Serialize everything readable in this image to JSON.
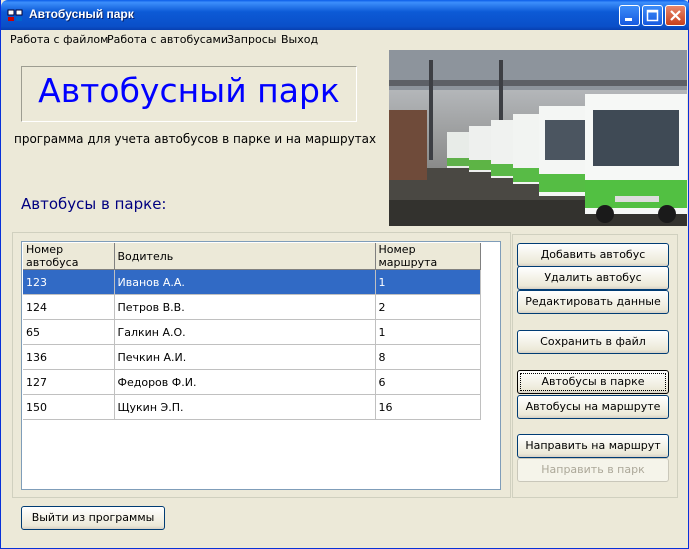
{
  "window": {
    "title": "Автобусный парк"
  },
  "menu": [
    {
      "label": "Работа с файлом"
    },
    {
      "label": "Работа с автобусами"
    },
    {
      "label": "Запросы"
    },
    {
      "label": "Выход"
    }
  ],
  "header": {
    "logo_text": "Автобусный парк",
    "subtitle": "программа для учета автобусов в парке и на  маршрутах"
  },
  "section_title": "Автобусы в парке:",
  "table": {
    "columns": [
      "Номер автобуса",
      "Водитель",
      "Номер маршрута"
    ],
    "rows": [
      [
        "123",
        "Иванов А.А.",
        "1"
      ],
      [
        "124",
        "Петров В.В.",
        "2"
      ],
      [
        "65",
        "Галкин А.О.",
        "1"
      ],
      [
        "136",
        "Печкин А.И.",
        "8"
      ],
      [
        "127",
        "Федоров Ф.И.",
        "6"
      ],
      [
        "150",
        "Щукин Э.П.",
        "16"
      ]
    ],
    "selected_row": 0
  },
  "buttons": {
    "add": "Добавить автобус",
    "delete": "Удалить автобус",
    "edit": "Редактировать данные",
    "save": "Сохранить в файл",
    "in_park": "Автобусы в парке",
    "on_route": "Автобусы на маршруте",
    "send_route": "Направить на маршрут",
    "send_park": "Направить в парк",
    "exit": "Выйти из программы"
  },
  "colors": {
    "selection": "#316ac5",
    "logo_text": "#0000ff",
    "section_title": "#000080"
  }
}
